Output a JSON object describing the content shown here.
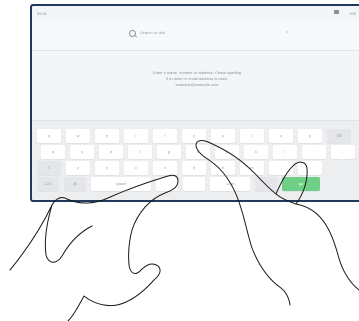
{
  "status": {
    "left_text": "09:41",
    "right_text": "100"
  },
  "search": {
    "placeholder": "Search or dial",
    "clear_glyph": "×"
  },
  "hint": {
    "lines": [
      "Enter a name, number or address. Check spelling",
      "if a name or email address is used.",
      "example@example.com"
    ]
  },
  "keyboard": {
    "row1": [
      "q",
      "w",
      "e",
      "r",
      "t",
      "y",
      "u",
      "i",
      "o",
      "p",
      "⌫"
    ],
    "row2": [
      "a",
      "s",
      "d",
      "f",
      "g",
      "h",
      "j",
      "k",
      "l",
      "'",
      "-"
    ],
    "row3": [
      "⇧",
      "z",
      "x",
      "c",
      "v",
      "b",
      "n",
      "m",
      ",",
      "."
    ],
    "row4": [
      "123",
      "@",
      "space",
      "",
      "",
      ".com",
      "",
      "go"
    ],
    "go_color": "#6fcf86"
  },
  "colors": {
    "device_border": "#1f3a5c",
    "screen_bg": "#f4f5f6"
  }
}
